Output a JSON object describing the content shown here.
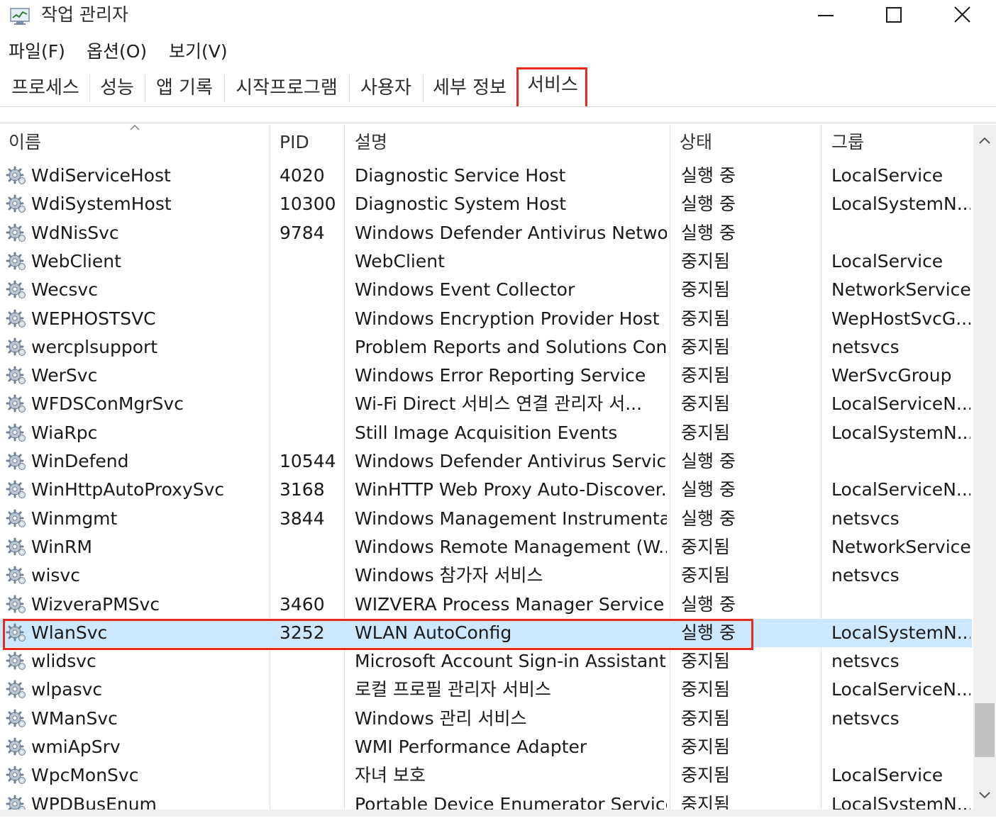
{
  "window": {
    "title": "작업 관리자",
    "icon": "task-manager-icon",
    "controls": [
      "minimize-icon",
      "maximize-icon",
      "close-icon"
    ]
  },
  "menu": {
    "file": "파일(F)",
    "options": "옵션(O)",
    "view": "보기(V)"
  },
  "tabs": [
    {
      "label": "프로세스",
      "active": false
    },
    {
      "label": "성능",
      "active": false
    },
    {
      "label": "앱 기록",
      "active": false
    },
    {
      "label": "시작프로그램",
      "active": false
    },
    {
      "label": "사용자",
      "active": false
    },
    {
      "label": "세부 정보",
      "active": false
    },
    {
      "label": "서비스",
      "active": true
    }
  ],
  "columns": {
    "name": "이름",
    "pid": "PID",
    "description": "설명",
    "status": "상태",
    "group": "그룹"
  },
  "rows": [
    {
      "name": "WdiServiceHost",
      "pid": "4020",
      "description": "Diagnostic Service Host",
      "status": "실행 중",
      "group": "LocalService"
    },
    {
      "name": "WdiSystemHost",
      "pid": "10300",
      "description": "Diagnostic System Host",
      "status": "실행 중",
      "group": "LocalSystemN..."
    },
    {
      "name": "WdNisSvc",
      "pid": "9784",
      "description": "Windows Defender Antivirus Netwo...",
      "status": "실행 중",
      "group": ""
    },
    {
      "name": "WebClient",
      "pid": "",
      "description": "WebClient",
      "status": "중지됨",
      "group": "LocalService"
    },
    {
      "name": "Wecsvc",
      "pid": "",
      "description": "Windows Event Collector",
      "status": "중지됨",
      "group": "NetworkService"
    },
    {
      "name": "WEPHOSTSVC",
      "pid": "",
      "description": "Windows Encryption Provider Host ...",
      "status": "중지됨",
      "group": "WepHostSvcG..."
    },
    {
      "name": "wercplsupport",
      "pid": "",
      "description": "Problem Reports and Solutions Con...",
      "status": "중지됨",
      "group": "netsvcs"
    },
    {
      "name": "WerSvc",
      "pid": "",
      "description": "Windows Error Reporting Service",
      "status": "중지됨",
      "group": "WerSvcGroup"
    },
    {
      "name": "WFDSConMgrSvc",
      "pid": "",
      "description": "Wi-Fi Direct 서비스 연결 관리자 서...",
      "status": "중지됨",
      "group": "LocalServiceN..."
    },
    {
      "name": "WiaRpc",
      "pid": "",
      "description": "Still Image Acquisition Events",
      "status": "중지됨",
      "group": "LocalSystemN..."
    },
    {
      "name": "WinDefend",
      "pid": "10544",
      "description": "Windows Defender Antivirus Service",
      "status": "실행 중",
      "group": ""
    },
    {
      "name": "WinHttpAutoProxySvc",
      "pid": "3168",
      "description": "WinHTTP Web Proxy Auto-Discover...",
      "status": "실행 중",
      "group": "LocalServiceN..."
    },
    {
      "name": "Winmgmt",
      "pid": "3844",
      "description": "Windows Management Instrumenta...",
      "status": "실행 중",
      "group": "netsvcs"
    },
    {
      "name": "WinRM",
      "pid": "",
      "description": "Windows Remote Management (W...",
      "status": "중지됨",
      "group": "NetworkService"
    },
    {
      "name": "wisvc",
      "pid": "",
      "description": "Windows 참가자 서비스",
      "status": "중지됨",
      "group": "netsvcs"
    },
    {
      "name": "WizveraPMSvc",
      "pid": "3460",
      "description": "WIZVERA Process Manager Service",
      "status": "실행 중",
      "group": ""
    },
    {
      "name": "WlanSvc",
      "pid": "3252",
      "description": "WLAN AutoConfig",
      "status": "실행 중",
      "group": "LocalSystemN...",
      "selected": true
    },
    {
      "name": "wlidsvc",
      "pid": "",
      "description": "Microsoft Account Sign-in Assistant",
      "status": "중지됨",
      "group": "netsvcs"
    },
    {
      "name": "wlpasvc",
      "pid": "",
      "description": "로컬 프로필 관리자 서비스",
      "status": "중지됨",
      "group": "LocalServiceN..."
    },
    {
      "name": "WManSvc",
      "pid": "",
      "description": "Windows 관리 서비스",
      "status": "중지됨",
      "group": "netsvcs"
    },
    {
      "name": "wmiApSrv",
      "pid": "",
      "description": "WMI Performance Adapter",
      "status": "중지됨",
      "group": ""
    },
    {
      "name": "WpcMonSvc",
      "pid": "",
      "description": "자녀 보호",
      "status": "중지됨",
      "group": "LocalService"
    },
    {
      "name": "WPDBusEnum",
      "pid": "",
      "description": "Portable Device Enumerator Service",
      "status": "중지됨",
      "group": "LocalSystemN..."
    }
  ],
  "colors": {
    "selected_row": "#cce8ff",
    "highlight_box": "#e52b1f",
    "scrollbar_track": "#f0f0f0",
    "scrollbar_thumb": "#c2c2c2"
  }
}
